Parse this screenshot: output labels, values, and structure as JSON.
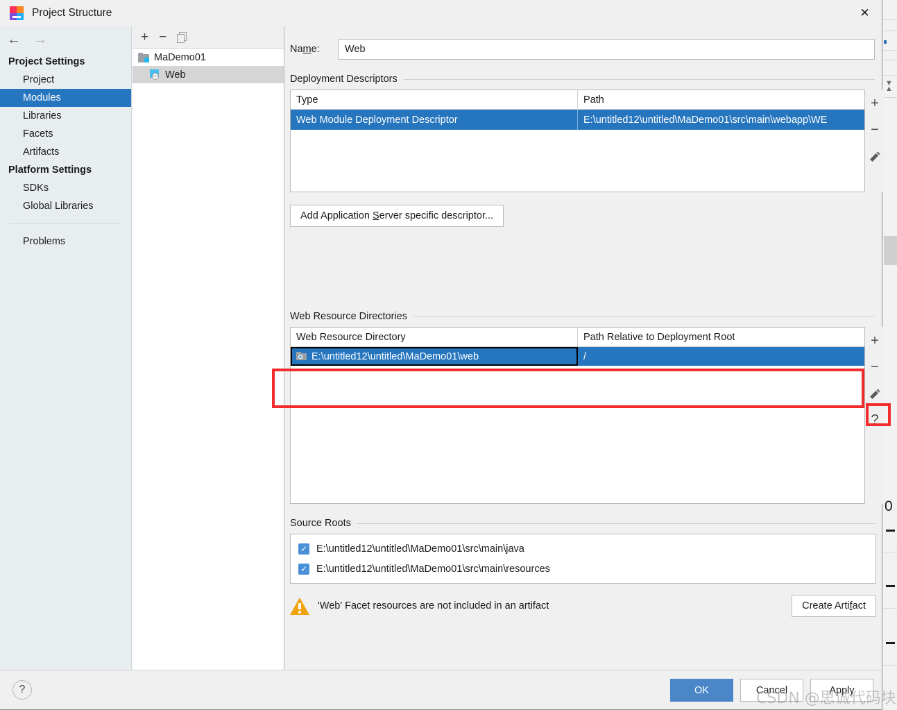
{
  "window": {
    "title": "Project Structure",
    "app_icon": "intellij-idea-icon",
    "close_label": "✕"
  },
  "navigation": {
    "back_icon": "←",
    "forward_icon": "→"
  },
  "sidebar": {
    "groups": [
      {
        "title": "Project Settings",
        "items": [
          {
            "label": "Project",
            "selected": false
          },
          {
            "label": "Modules",
            "selected": true
          },
          {
            "label": "Libraries",
            "selected": false
          },
          {
            "label": "Facets",
            "selected": false
          },
          {
            "label": "Artifacts",
            "selected": false
          }
        ]
      },
      {
        "title": "Platform Settings",
        "items": [
          {
            "label": "SDKs",
            "selected": false
          },
          {
            "label": "Global Libraries",
            "selected": false
          }
        ]
      }
    ],
    "extra_items": [
      {
        "label": "Problems",
        "selected": false
      }
    ]
  },
  "module_tree": {
    "toolbar": {
      "add_label": "+",
      "remove_label": "−",
      "copy_label": "copy-icon"
    },
    "rows": [
      {
        "label": "MaDemo01",
        "icon": "module-folder-icon",
        "indent": false,
        "selected": false
      },
      {
        "label": "Web",
        "icon": "web-facet-icon",
        "indent": true,
        "selected": true
      }
    ]
  },
  "main": {
    "name_field": {
      "label_prefix": "Na",
      "label_mnemonic": "m",
      "label_suffix": "e:",
      "value": "Web",
      "placeholder": ""
    },
    "deployment_descriptors": {
      "title": "Deployment Descriptors",
      "columns": [
        "Type",
        "Path"
      ],
      "rows": [
        {
          "type": "Web Module Deployment Descriptor",
          "path": "E:\\untitled12\\untitled\\MaDemo01\\src\\main\\webapp\\WE",
          "selected": true
        }
      ],
      "toolbar": [
        {
          "name": "add",
          "label": "+"
        },
        {
          "name": "remove",
          "label": "−"
        },
        {
          "name": "edit",
          "label": "pencil-icon"
        }
      ],
      "add_descriptor_button": {
        "prefix": "Add Application ",
        "mnemonic": "S",
        "suffix": "erver specific descriptor..."
      }
    },
    "web_resource_directories": {
      "title": "Web Resource Directories",
      "columns": [
        "Web Resource Directory",
        "Path Relative to Deployment Root"
      ],
      "rows": [
        {
          "directory": "E:\\untitled12\\untitled\\MaDemo01\\web",
          "relative_path": "/",
          "selected": true,
          "icon": "web-folder-icon"
        }
      ],
      "toolbar": [
        {
          "name": "add",
          "label": "+"
        },
        {
          "name": "remove",
          "label": "−"
        },
        {
          "name": "edit",
          "label": "pencil-icon",
          "highlighted": true
        },
        {
          "name": "help",
          "label": "?"
        }
      ]
    },
    "source_roots": {
      "title": "Source Roots",
      "items": [
        {
          "path": "E:\\untitled12\\untitled\\MaDemo01\\src\\main\\java",
          "checked": true
        },
        {
          "path": "E:\\untitled12\\untitled\\MaDemo01\\src\\main\\resources",
          "checked": true
        }
      ]
    },
    "warning": {
      "icon": "warning-triangle-icon",
      "text": "'Web' Facet resources are not included in an artifact",
      "button": {
        "prefix": "Create Arti",
        "mnemonic": "f",
        "suffix": "act"
      }
    }
  },
  "footer": {
    "help_label": "?",
    "buttons": [
      {
        "name": "ok",
        "label": "OK",
        "primary": true
      },
      {
        "name": "cancel",
        "label": "Cancel",
        "primary": false
      },
      {
        "name": "apply",
        "label": "Apply",
        "primary": false
      }
    ]
  },
  "annotations": {
    "red_boxes": [
      {
        "name": "web-resource-row-highlight"
      },
      {
        "name": "edit-pencil-highlight"
      }
    ]
  },
  "watermark": {
    "text": "CSDN @思诚代码块"
  },
  "colors": {
    "accent": "#2675bf",
    "primary_button": "#4a86c8",
    "annotation": "#f22c2c",
    "warning": "#f0a30a",
    "checkbox": "#4a90d9"
  },
  "background_ide": {
    "zero_glyph": "0"
  }
}
